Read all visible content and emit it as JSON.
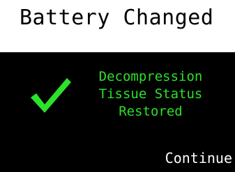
{
  "header": {
    "title": "Battery Changed"
  },
  "message": {
    "lines": [
      "Decompression",
      "Tissue Status",
      "Restored"
    ]
  },
  "status_icon": "checkmark-icon",
  "actions": {
    "continue_label": "Continue"
  },
  "colors": {
    "header_bg": "#ffffff",
    "screen_bg": "#000000",
    "accent_green": "#2ce02c",
    "button_text": "#ffffff"
  }
}
